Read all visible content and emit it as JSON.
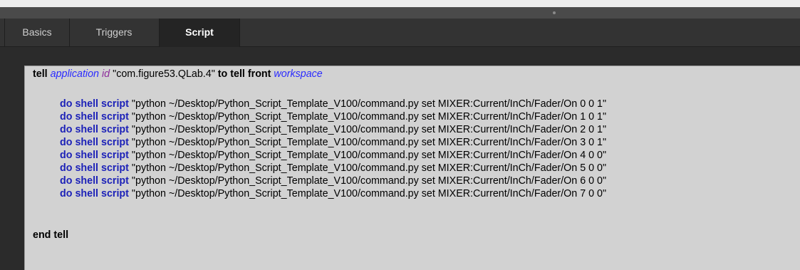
{
  "tabs": [
    {
      "label": "Basics"
    },
    {
      "label": "Triggers"
    },
    {
      "label": "Script"
    }
  ],
  "script": {
    "tell_kw": "tell",
    "application_kw": "application",
    "id_kw": "id",
    "app_id_string": "\"com.figure53.QLab.4\"",
    "to_tell_front": "to tell front",
    "workspace_kw": "workspace",
    "do_shell_script": "do shell script",
    "commands": [
      "\"python ~/Desktop/Python_Script_Template_V100/command.py set MIXER:Current/InCh/Fader/On 0 0 1\"",
      "\"python ~/Desktop/Python_Script_Template_V100/command.py set MIXER:Current/InCh/Fader/On 1 0 1\"",
      "\"python ~/Desktop/Python_Script_Template_V100/command.py set MIXER:Current/InCh/Fader/On 2 0 1\"",
      "\"python ~/Desktop/Python_Script_Template_V100/command.py set MIXER:Current/InCh/Fader/On 3 0 1\"",
      "\"python ~/Desktop/Python_Script_Template_V100/command.py set MIXER:Current/InCh/Fader/On 4 0 0\"",
      "\"python ~/Desktop/Python_Script_Template_V100/command.py set MIXER:Current/InCh/Fader/On 5 0 0\"",
      "\"python ~/Desktop/Python_Script_Template_V100/command.py set MIXER:Current/InCh/Fader/On 6 0 0\"",
      "\"python ~/Desktop/Python_Script_Template_V100/command.py set MIXER:Current/InCh/Fader/On 7 0 0\""
    ],
    "end_tell": "end tell"
  },
  "colors": {
    "keyword_blue": "#1d22b8",
    "class_blue": "#2b2bff",
    "property_purple": "#8e2f9c",
    "editor_bg": "#d2d2d2"
  }
}
